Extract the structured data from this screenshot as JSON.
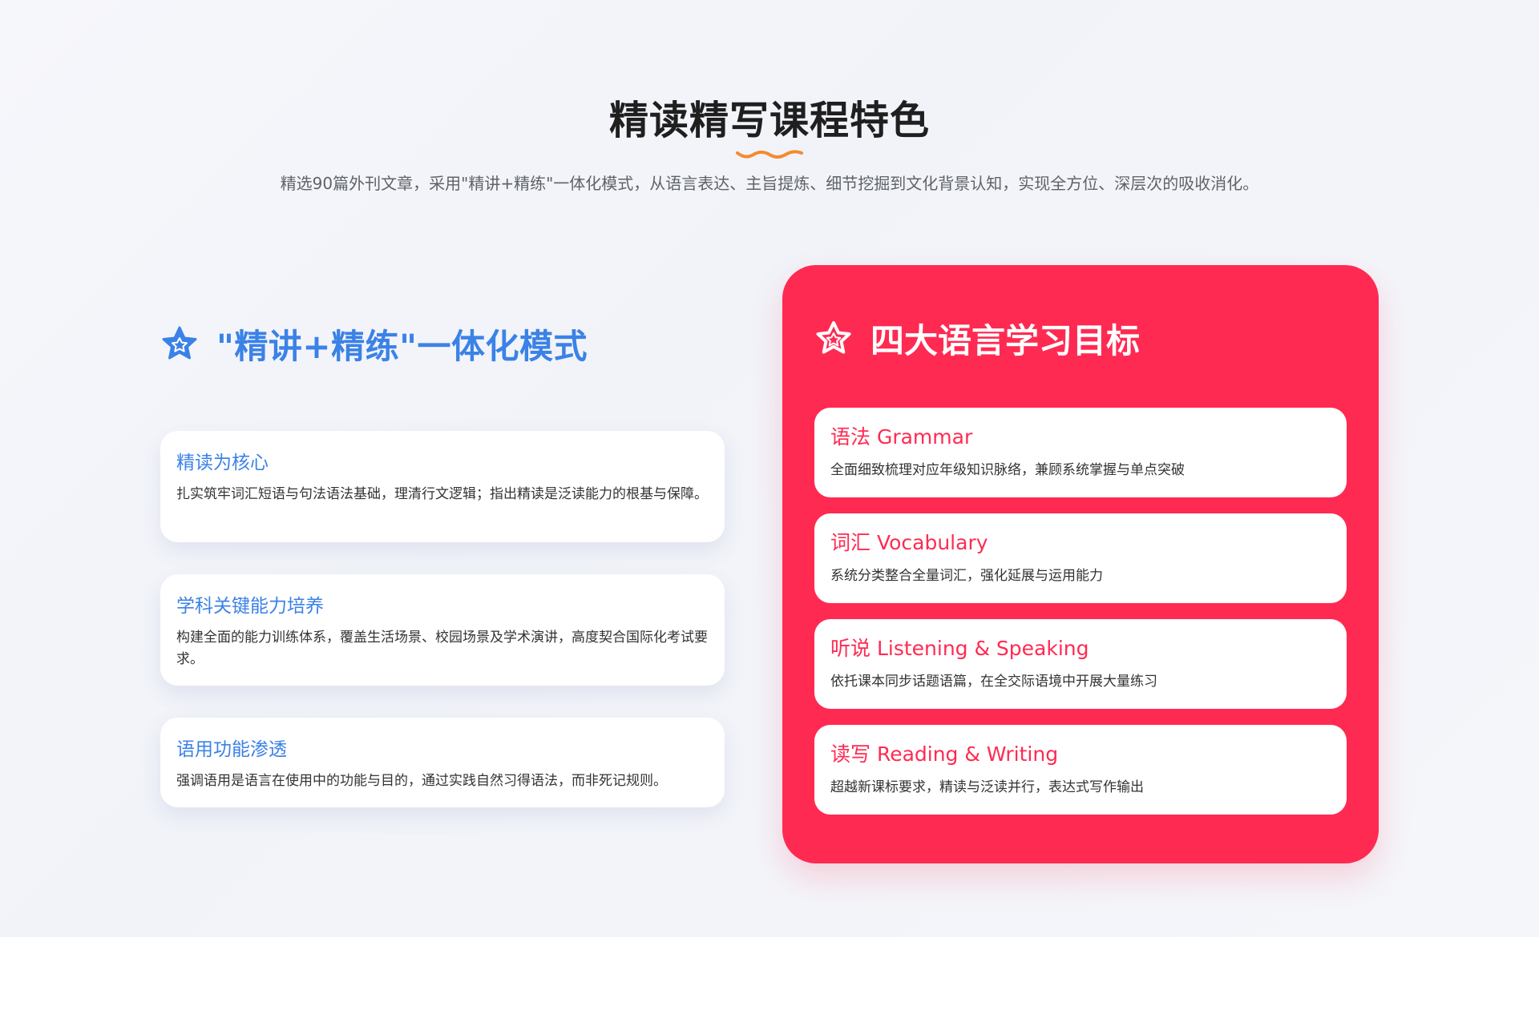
{
  "header": {
    "title": "精读精写课程特色",
    "subtitle": "精选90篇外刊文章，采用\"精讲+精练\"一体化模式，从语言表达、主旨提炼、细节挖掘到文化背景认知，实现全方位、深层次的吸收消化。"
  },
  "mode_section": {
    "title": "\"精讲+精练\"一体化模式",
    "icon": "star-icon",
    "cards": [
      {
        "title": "精读为核心",
        "desc": "扎实筑牢词汇短语与句法语法基础，理清行文逻辑；指出精读是泛读能力的根基与保障。"
      },
      {
        "title": "学科关键能力培养",
        "desc": "构建全面的能力训练体系，覆盖生活场景、校园场景及学术演讲，高度契合国际化考试要求。"
      },
      {
        "title": "语用功能渗透",
        "desc": "强调语用是语言在使用中的功能与目的，通过实践自然习得语法，而非死记规则。"
      }
    ]
  },
  "goals_section": {
    "title": "四大语言学习目标",
    "icon": "star-icon",
    "cards": [
      {
        "title": "语法 Grammar",
        "desc": "全面细致梳理对应年级知识脉络，兼顾系统掌握与单点突破"
      },
      {
        "title": "词汇 Vocabulary",
        "desc": "系统分类整合全量词汇，强化延展与运用能力"
      },
      {
        "title": "听说 Listening & Speaking",
        "desc": "依托课本同步话题语篇，在全交际语境中开展大量练习"
      },
      {
        "title": "读写 Reading & Writing",
        "desc": "超越新课标要求，精读与泛读并行，表达式写作输出"
      }
    ]
  },
  "colors": {
    "accent_blue": "#3b82e6",
    "accent_red": "#ff2a52",
    "wave_orange": "#f58a2e"
  }
}
